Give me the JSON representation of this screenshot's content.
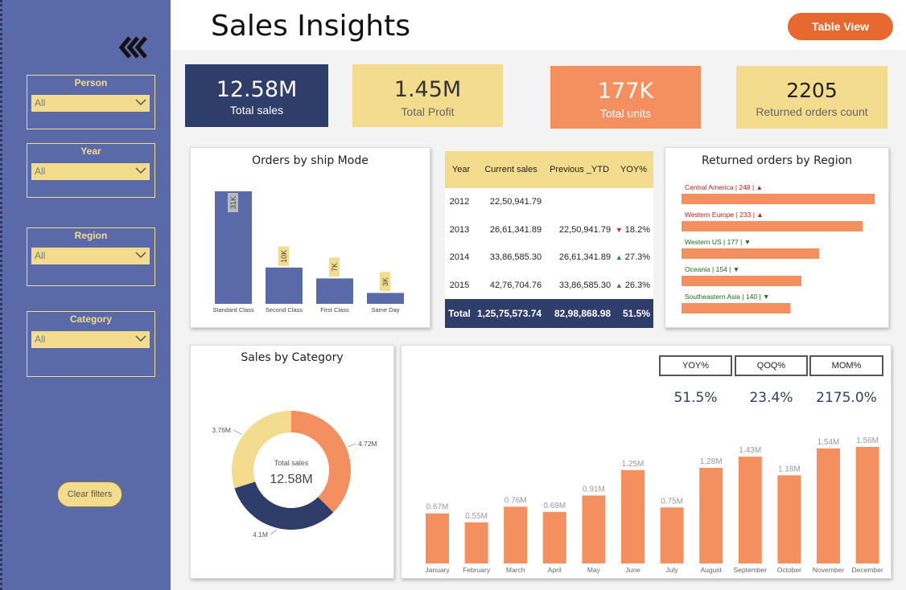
{
  "header": {
    "title": "Sales Insights",
    "table_view_label": "Table View"
  },
  "sidebar": {
    "slicers": [
      {
        "title": "Person",
        "value": "All"
      },
      {
        "title": "Year",
        "value": "All"
      },
      {
        "title": "Region",
        "value": "All"
      },
      {
        "title": "Category",
        "value": "All"
      }
    ],
    "clear_filters_label": "Clear filters"
  },
  "kpis": [
    {
      "value": "12.58M",
      "label": "Total sales"
    },
    {
      "value": "1.45M",
      "label": "Total Profit"
    },
    {
      "value": "177K",
      "label": "Total units"
    },
    {
      "value": "2205",
      "label": "Returned orders count"
    }
  ],
  "colors": {
    "navy": "#2f3d6b",
    "sidebar": "#5a6aa8",
    "yellow": "#f3dc8d",
    "orange": "#f4905f",
    "accent": "#e8692f"
  },
  "ship_mode": {
    "title": "Orders by ship Mode"
  },
  "yoy_table": {
    "headers": [
      "Year",
      "Current sales",
      "Previous _YTD",
      "YOY%"
    ],
    "rows": [
      {
        "year": "2012",
        "current": "22,50,941.79",
        "previous": "",
        "yoy": "",
        "trend": ""
      },
      {
        "year": "2013",
        "current": "26,61,341.89",
        "previous": "22,50,941.79",
        "yoy": "18.2%",
        "trend": "down"
      },
      {
        "year": "2014",
        "current": "33,86,585.30",
        "previous": "26,61,341.89",
        "yoy": "27.3%",
        "trend": "up"
      },
      {
        "year": "2015",
        "current": "42,76,704.76",
        "previous": "33,86,585.30",
        "yoy": "26.3%",
        "trend": "up"
      }
    ],
    "total": {
      "label": "Total",
      "current": "1,25,75,573.74",
      "previous": "82,98,868.98",
      "yoy": "51.5%"
    }
  },
  "returned_by_region": {
    "title": "Returned orders by Region"
  },
  "sales_by_category": {
    "title": "Sales by Category",
    "center_label": "Total sales",
    "center_value": "12.58M"
  },
  "metrics": [
    {
      "label": "YOY%",
      "value": "51.5%"
    },
    {
      "label": "QOQ%",
      "value": "23.4%"
    },
    {
      "label": "MOM%",
      "value": "2175.0%"
    }
  ],
  "chart_data": [
    {
      "type": "bar",
      "title": "Orders by ship Mode",
      "categories": [
        "Standard Class",
        "Second Class",
        "First Class",
        "Same Day"
      ],
      "values": [
        31000,
        10000,
        7000,
        3000
      ],
      "data_labels": [
        "31K",
        "10K",
        "7K",
        "3K"
      ]
    },
    {
      "type": "bar",
      "title": "Returned orders by Region",
      "categories": [
        "Central America",
        "Western Europe",
        "Western US",
        "Oceania",
        "Southeastern Asia"
      ],
      "values": [
        248,
        233,
        177,
        154,
        140
      ],
      "trends": [
        "up",
        "up",
        "down",
        "down",
        "down"
      ],
      "orientation": "horizontal"
    },
    {
      "type": "pie",
      "title": "Sales by Category",
      "labels": [
        "4.72M",
        "4.1M",
        "3.76M"
      ],
      "values": [
        4.72,
        4.1,
        3.76
      ],
      "colors": [
        "#f4905f",
        "#2f3d6b",
        "#f3dc8d"
      ]
    },
    {
      "type": "bar",
      "categories": [
        "January",
        "February",
        "March",
        "April",
        "May",
        "June",
        "July",
        "August",
        "September",
        "October",
        "November",
        "December"
      ],
      "values": [
        0.67,
        0.55,
        0.76,
        0.69,
        0.91,
        1.25,
        0.75,
        1.28,
        1.43,
        1.18,
        1.54,
        1.56
      ],
      "data_labels": [
        "0.67M",
        "0.55M",
        "0.76M",
        "0.69M",
        "0.91M",
        "1.25M",
        "0.75M",
        "1.28M",
        "1.43M",
        "1.18M",
        "1.54M",
        "1.56M"
      ]
    }
  ]
}
